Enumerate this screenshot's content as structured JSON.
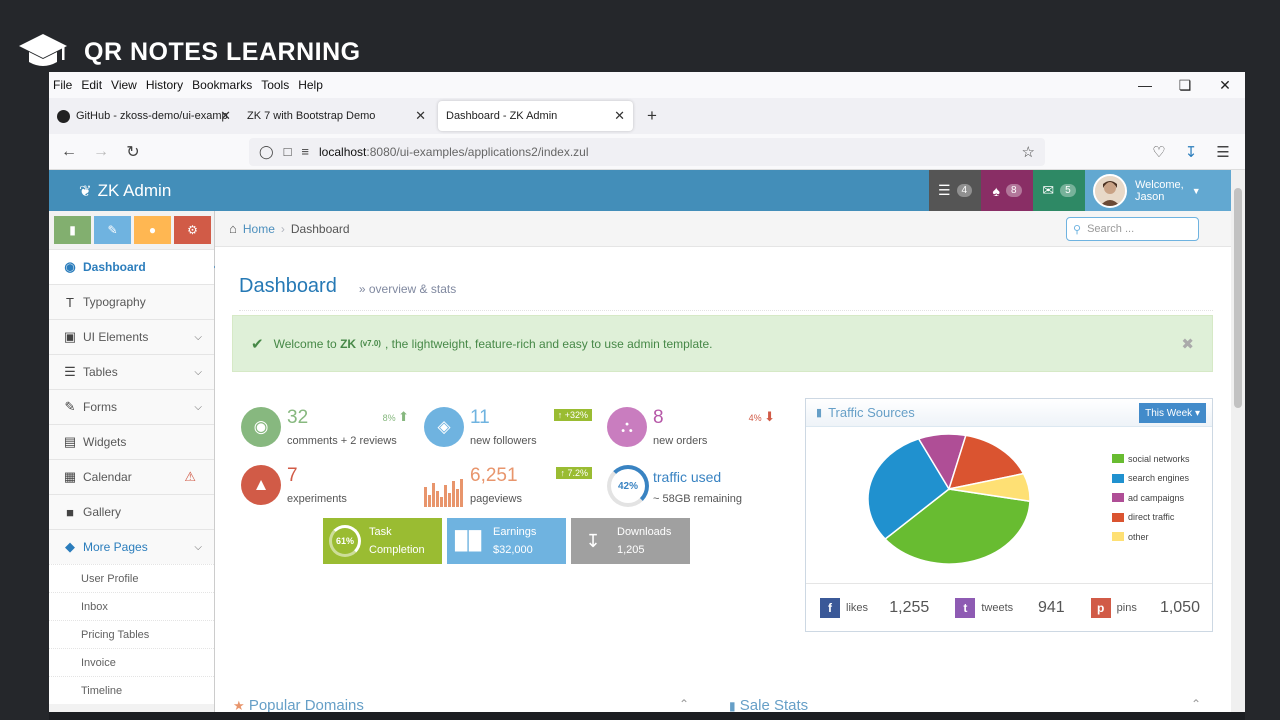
{
  "brand": {
    "title": "QR NOTES LEARNING"
  },
  "browser": {
    "menu": [
      "File",
      "Edit",
      "View",
      "History",
      "Bookmarks",
      "Tools",
      "Help"
    ],
    "tabs": [
      {
        "label": "GitHub - zkoss-demo/ui-examp"
      },
      {
        "label": "ZK 7 with Bootstrap Demo"
      },
      {
        "label": "Dashboard - ZK Admin"
      }
    ],
    "url_host": "localhost",
    "url_rest": ":8080/ui-examples/applications2/index.zul"
  },
  "app": {
    "logo": "ZK Admin",
    "header": {
      "tasks_count": "4",
      "notifications_count": "8",
      "messages_count": "5",
      "welcome": "Welcome,",
      "user": "Jason"
    },
    "sidebar": {
      "items": [
        {
          "label": "Dashboard"
        },
        {
          "label": "Typography"
        },
        {
          "label": "UI Elements"
        },
        {
          "label": "Tables"
        },
        {
          "label": "Forms"
        },
        {
          "label": "Widgets"
        },
        {
          "label": "Calendar"
        },
        {
          "label": "Gallery"
        },
        {
          "label": "More Pages"
        }
      ],
      "subitems": [
        {
          "label": "User Profile"
        },
        {
          "label": "Inbox"
        },
        {
          "label": "Pricing Tables"
        },
        {
          "label": "Invoice"
        },
        {
          "label": "Timeline"
        }
      ]
    },
    "breadcrumb": {
      "home": "Home",
      "current": "Dashboard"
    },
    "search_placeholder": "Search ...",
    "page": {
      "title": "Dashboard",
      "subtitle": "overview & stats"
    },
    "alert": {
      "pre": "Welcome to",
      "brand": "ZK",
      "version": "(v7.0)",
      "post": ", the lightweight, feature-rich and easy to use admin template."
    },
    "stats": {
      "comments": {
        "value": "32",
        "label": "comments + 2 reviews",
        "badge": "8%"
      },
      "followers": {
        "value": "11",
        "label": "new followers",
        "badge": "+32%"
      },
      "orders": {
        "value": "8",
        "label": "new orders",
        "badge": "4%"
      },
      "experiments": {
        "value": "7",
        "label": "experiments"
      },
      "pageviews": {
        "value": "6,251",
        "label": "pageviews",
        "badge": "7.2%"
      },
      "traffic": {
        "percent": "42%",
        "label": "traffic used",
        "sub": "~ 58GB remaining"
      }
    },
    "tiles": {
      "task": {
        "percent": "61%",
        "line1": "Task",
        "line2": "Completion"
      },
      "earnings": {
        "line1": "Earnings",
        "line2": "$32,000"
      },
      "downloads": {
        "line1": "Downloads",
        "line2": "1,205"
      }
    },
    "traffic_widget": {
      "title": "Traffic Sources",
      "period_button": "This Week",
      "legend": [
        "social networks",
        "search engines",
        "ad campaigns",
        "direct traffic",
        "other"
      ],
      "colors": [
        "#68bc31",
        "#2091cf",
        "#af4e96",
        "#da5430",
        "#fee074"
      ],
      "social": [
        {
          "label": "likes",
          "value": "1,255"
        },
        {
          "label": "tweets",
          "value": "941"
        },
        {
          "label": "pins",
          "value": "1,050"
        }
      ]
    },
    "bottom": {
      "left_title": "Popular Domains",
      "right_title": "Sale Stats"
    }
  }
}
